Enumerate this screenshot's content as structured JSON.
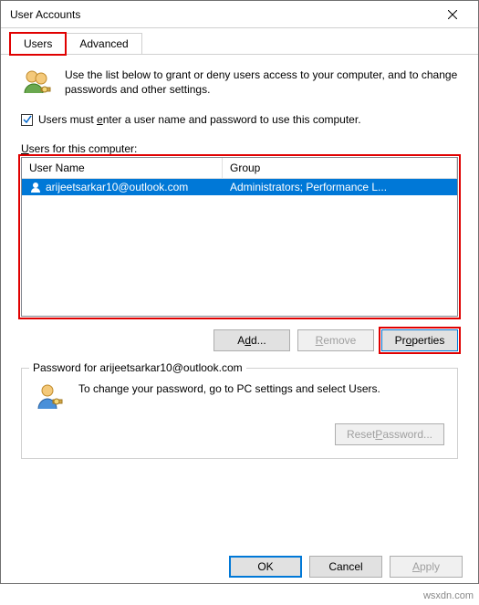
{
  "title": "User Accounts",
  "tabs": {
    "users": "Users",
    "advanced": "Advanced"
  },
  "intro_text": "Use the list below to grant or deny users access to your computer, and to change passwords and other settings.",
  "must_enter_label": "Users must enter a user name and password to use this computer.",
  "must_enter_checked": true,
  "users_list_label": "Users for this computer:",
  "columns": {
    "user": "User Name",
    "group": "Group"
  },
  "rows": [
    {
      "username": "arijeetsarkar10@outlook.com",
      "group": "Administrators; Performance L..."
    }
  ],
  "buttons": {
    "add": "Add...",
    "remove": "Remove",
    "properties": "Properties",
    "reset_pw": "Reset Password...",
    "ok": "OK",
    "cancel": "Cancel",
    "apply": "Apply"
  },
  "pw_group_title": "Password for arijeetsarkar10@outlook.com",
  "pw_text": "To change your password, go to PC settings and select Users.",
  "watermark": "wsxdn.com"
}
